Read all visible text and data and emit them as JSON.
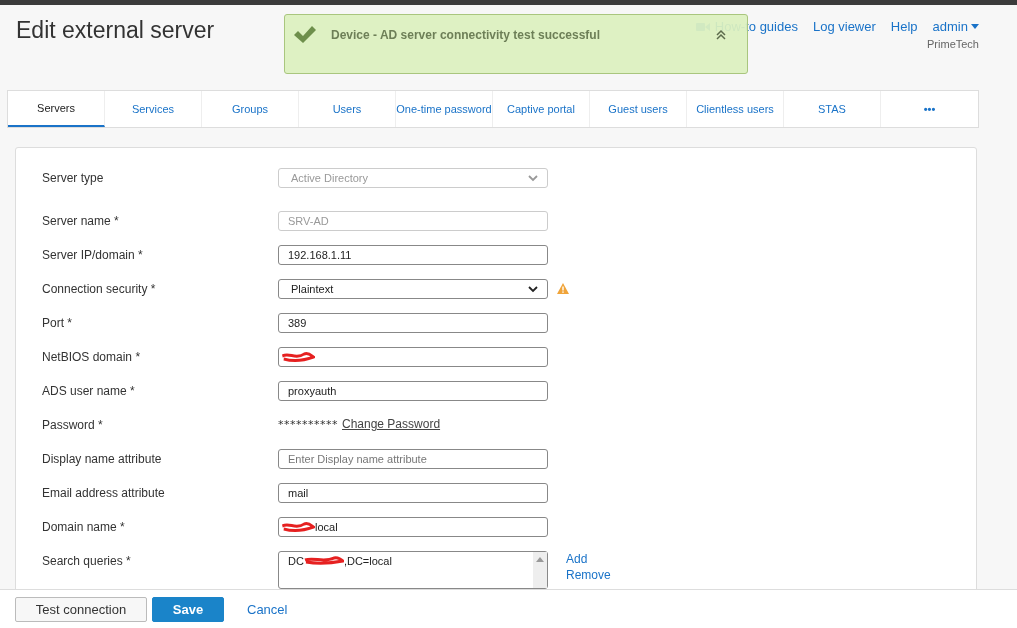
{
  "header": {
    "title": "Edit external server",
    "links": [
      "How-to guides",
      "Log viewer",
      "Help"
    ],
    "user": "admin",
    "company": "PrimeTech"
  },
  "toast": {
    "message": "Device - AD server connectivity test successful"
  },
  "tabs": [
    {
      "label": "Servers",
      "selected": true
    },
    {
      "label": "Services",
      "selected": false
    },
    {
      "label": "Groups",
      "selected": false
    },
    {
      "label": "Users",
      "selected": false
    },
    {
      "label": "One-time password",
      "selected": false
    },
    {
      "label": "Captive portal",
      "selected": false
    },
    {
      "label": "Guest users",
      "selected": false
    },
    {
      "label": "Clientless users",
      "selected": false
    },
    {
      "label": "STAS",
      "selected": false
    },
    {
      "label": "•••",
      "selected": false
    }
  ],
  "form": {
    "fields": [
      {
        "kind": "select",
        "label": "Server type",
        "value": "Active Directory",
        "disabled": true
      },
      {
        "kind": "input",
        "label": "Server name *",
        "value": "SRV-AD",
        "disabled": true
      },
      {
        "kind": "input",
        "label": "Server IP/domain *",
        "value": "192.168.1.11",
        "disabled": false
      },
      {
        "kind": "select",
        "label": "Connection security *",
        "value": "Plaintext",
        "disabled": false,
        "warning": true
      },
      {
        "kind": "input",
        "label": "Port *",
        "value": "389",
        "disabled": false
      },
      {
        "kind": "input",
        "label": "NetBIOS domain *",
        "disabled": false,
        "redacted": true
      },
      {
        "kind": "input",
        "label": "ADS user name *",
        "value": "proxyauth",
        "disabled": false
      },
      {
        "kind": "password",
        "label": "Password *",
        "value": "**********",
        "link": "Change Password"
      },
      {
        "kind": "input",
        "label": "Display name attribute",
        "placeholder": "Enter Display name attribute",
        "disabled": false
      },
      {
        "kind": "input",
        "label": "Email address attribute",
        "value": "mail",
        "disabled": false
      },
      {
        "kind": "input",
        "label": "Domain name *",
        "value": "local",
        "disabled": false,
        "redacted": true
      },
      {
        "kind": "list",
        "label": "Search queries *",
        "before": "DC",
        "value": ",DC=local",
        "redacted": true,
        "actions": [
          "Add",
          "Remove"
        ]
      }
    ]
  },
  "footer": {
    "buttons": [
      {
        "label": "Test connection",
        "kind": "default"
      },
      {
        "label": "Save",
        "kind": "primary"
      },
      {
        "label": "Cancel",
        "kind": "link"
      }
    ]
  }
}
